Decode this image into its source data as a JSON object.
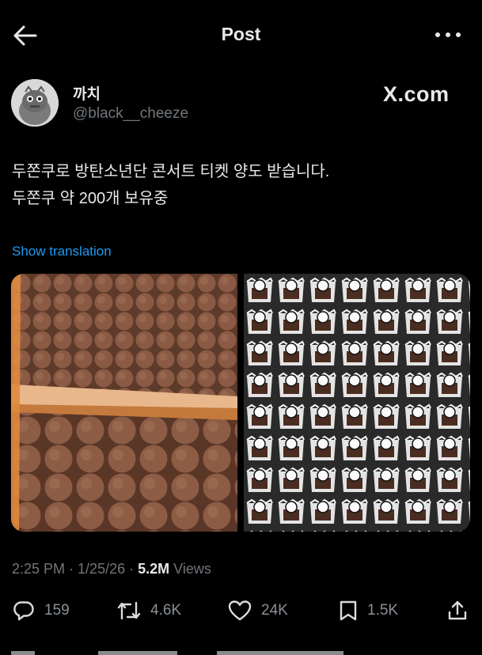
{
  "header": {
    "title": "Post"
  },
  "icons": {
    "back": "arrow-left-icon",
    "more": "more-horizontal-icon"
  },
  "author": {
    "display_name": "까치",
    "handle": "@black__cheeze",
    "source_label": "X.com"
  },
  "tweet": {
    "lines": [
      "두쫀쿠로 방탄소년단 콘서트 티켓 양도 받습니다.",
      "두쫀쿠 약 200개 보유중"
    ],
    "translate_label": "Show translation"
  },
  "meta": {
    "time": "2:25 PM",
    "separator": " · ",
    "date": "1/25/26",
    "views_count": "5.2M",
    "views_label": "Views"
  },
  "stats": {
    "replies": "159",
    "reposts": "4.6K",
    "likes": "24K",
    "bookmarks": "1.5K"
  },
  "colors": {
    "background": "#000000",
    "text": "#e7e9ea",
    "secondary": "#71767b",
    "link": "#1d9bf0"
  }
}
